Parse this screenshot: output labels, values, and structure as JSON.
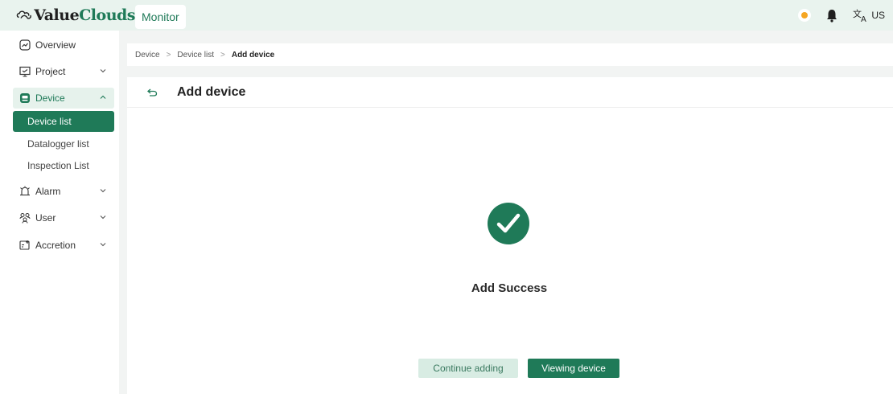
{
  "header": {
    "logo_text_part1": "Value",
    "logo_text_part2": "Clouds",
    "tab_label": "Monitor",
    "lang_label": "US"
  },
  "sidebar": {
    "items": [
      {
        "label": "Overview",
        "icon": "overview-icon"
      },
      {
        "label": "Project",
        "icon": "project-icon"
      },
      {
        "label": "Device",
        "icon": "device-icon"
      },
      {
        "label": "Alarm",
        "icon": "alarm-icon"
      },
      {
        "label": "User",
        "icon": "user-icon"
      },
      {
        "label": "Accretion",
        "icon": "accretion-icon"
      }
    ],
    "device_sub": [
      {
        "label": "Device list"
      },
      {
        "label": "Datalogger list"
      },
      {
        "label": "Inspection List"
      }
    ]
  },
  "breadcrumb": {
    "items": [
      "Device",
      "Device list",
      "Add device"
    ]
  },
  "panel": {
    "title": "Add device",
    "success_text": "Add Success",
    "continue_label": "Continue adding",
    "view_label": "Viewing device"
  },
  "colors": {
    "brand": "#1f7a58",
    "header_bg": "#e9f3ee",
    "continue_bg": "#d8ece3"
  }
}
